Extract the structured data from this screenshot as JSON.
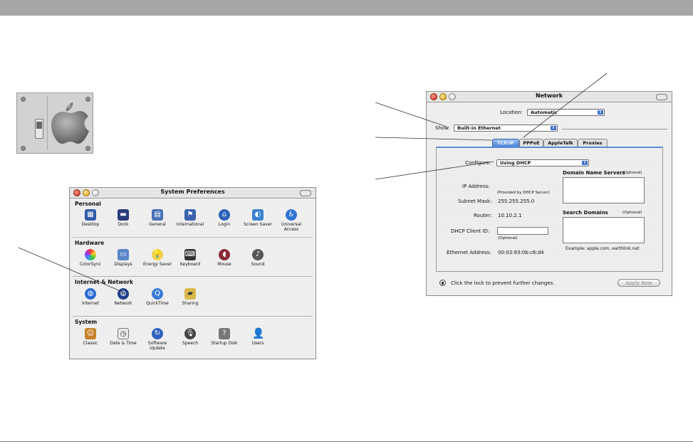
{
  "system_preferences": {
    "title": "System Preferences",
    "sections": [
      {
        "label": "Personal",
        "items": [
          "Desktop",
          "Dock",
          "General",
          "International",
          "Login",
          "Screen Saver",
          "Universal Access"
        ]
      },
      {
        "label": "Hardware",
        "items": [
          "ColorSync",
          "Displays",
          "Energy Saver",
          "Keyboard",
          "Mouse",
          "Sound"
        ]
      },
      {
        "label": "Internet & Network",
        "items": [
          "Internet",
          "Network",
          "QuickTime",
          "Sharing"
        ]
      },
      {
        "label": "System",
        "items": [
          "Classic",
          "Date & Time",
          "Software Update",
          "Speech",
          "Startup Disk",
          "Users"
        ]
      }
    ]
  },
  "network": {
    "title": "Network",
    "location_label": "Location:",
    "location_value": "Automatic",
    "show_label": "Show:",
    "show_value": "Built-in Ethernet",
    "tabs": [
      "TCP/IP",
      "PPPoE",
      "AppleTalk",
      "Proxies"
    ],
    "active_tab": "TCP/IP",
    "configure_label": "Configure:",
    "configure_value": "Using DHCP",
    "dns_label": "Domain Name Servers",
    "dns_optional": "(Optional)",
    "ip_label": "IP Address:",
    "ip_note": "(Provided by DHCP Server)",
    "subnet_label": "Subnet Mask:",
    "subnet_value": "255.255.255.0",
    "router_label": "Router:",
    "router_value": "10.10.2.1",
    "search_label": "Search Domains",
    "search_optional": "(Optional)",
    "dhcp_label": "DHCP Client ID:",
    "dhcp_optional": "(Optional)",
    "example_text": "Example: apple.com, earthlink.net",
    "ethernet_label": "Ethernet Address:",
    "ethernet_value": "00:03:93:0b:c6:d4",
    "lock_text": "Click the lock to prevent further changes.",
    "apply_label": "Apply Now"
  }
}
